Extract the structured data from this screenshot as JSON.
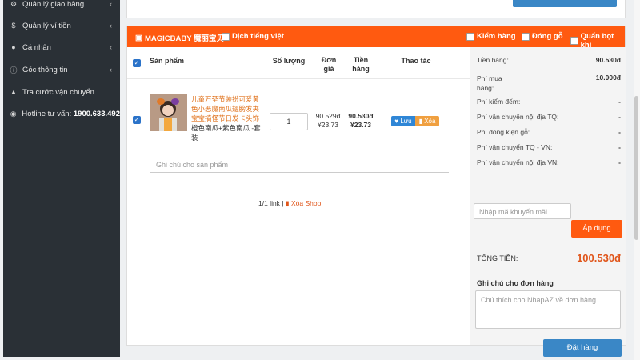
{
  "sidebar": {
    "items": [
      {
        "icon": "gear-icon",
        "label": "Quản lý giao hàng",
        "has_chevron": true
      },
      {
        "icon": "dollar-icon",
        "label": "Quản lý ví tiền",
        "has_chevron": true
      },
      {
        "icon": "user-icon",
        "label": "Cá nhân",
        "has_chevron": true
      },
      {
        "icon": "info-icon",
        "label": "Góc thông tin",
        "has_chevron": true
      },
      {
        "icon": "truck-icon",
        "label": "Tra cước vận chuyển",
        "has_chevron": false
      },
      {
        "icon": "globe-icon",
        "label": "Hotline tư vấn:",
        "value": "1900.633.492",
        "has_chevron": false
      }
    ]
  },
  "shop": {
    "icon": "shop-icon",
    "name": "MAGICBABY 魔丽宝贝",
    "translate_label": "Dịch tiếng việt",
    "options": [
      "Kiểm hàng",
      "Đóng gỗ",
      "Quấn bọt khí"
    ]
  },
  "table": {
    "headers": [
      "Sản phẩm",
      "Số lượng",
      "Đơn giá",
      "Tiền hàng",
      "Thao tác"
    ],
    "product": {
      "title": "儿童万圣节装扮可爱黄色小恶魔南瓜翅膀发夹宝宝搞怪节日发卡头饰",
      "variant": "橙色南瓜+紫色南瓜 -套装",
      "quantity": "1",
      "unit_price_vnd": "90.529đ",
      "unit_price_cny": "¥23.73",
      "total_vnd": "90.530đ",
      "total_cny": "¥23.73",
      "save_label": "Lưu",
      "delete_label": "Xóa"
    },
    "note_placeholder": "Ghi chú cho sản phẩm",
    "link_info": "1/1 link |",
    "delete_shop": "Xóa Shop"
  },
  "summary": {
    "rows": [
      {
        "label": "Tiền hàng:",
        "value": "90.530đ"
      },
      {
        "label": "Phí mua hàng:",
        "value": "10.000đ"
      },
      {
        "label": "Phí kiểm đếm:",
        "value": "-"
      },
      {
        "label": "Phí vận chuyển nội địa TQ:",
        "value": "-"
      },
      {
        "label": "Phí đóng kiện gỗ:",
        "value": "-"
      },
      {
        "label": "Phí vận chuyển TQ - VN:",
        "value": "-"
      },
      {
        "label": "Phí vận chuyển nội địa VN:",
        "value": "-"
      }
    ],
    "promo_placeholder": "Nhập mã khuyến mãi",
    "apply_label": "Áp dụng",
    "total_label": "TỔNG TIỀN:",
    "total_value": "100.530đ",
    "order_note_label": "Ghi chú cho đơn hàng",
    "order_note_placeholder": "Chú thích cho NhapAZ về đơn hàng",
    "order_button": "Đặt hàng"
  },
  "colors": {
    "accent_orange": "#ff5a10",
    "primary_blue": "#3a87c6",
    "sidebar_bg": "#2a3036"
  }
}
